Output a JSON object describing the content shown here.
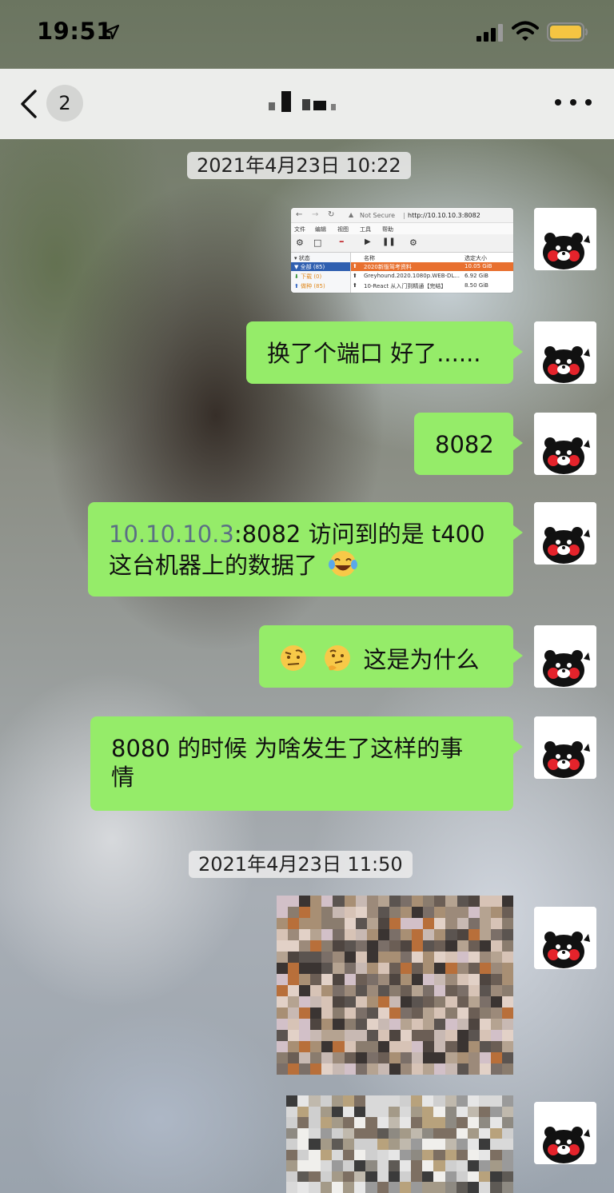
{
  "status_bar": {
    "time": "19:51"
  },
  "nav": {
    "unread_count": "2"
  },
  "colors": {
    "bubble": "#95ec69",
    "navbar": "#ecedeb"
  },
  "chat": {
    "timestamp_1": "2021年4月23日 10:22",
    "timestamp_2": "2021年4月23日 11:50",
    "screenshot": {
      "url_prefix": "Not Secure",
      "url": "http://10.10.10.3:8082",
      "menu": [
        "文件",
        "编辑",
        "视图",
        "工具",
        "帮助"
      ],
      "sidebar": [
        "状态",
        "全部 (85)",
        "下载 (0)",
        "做种 (85)"
      ],
      "headers": [
        "名称",
        "选定大小"
      ],
      "rows": [
        {
          "name": "2020新版驾考资料",
          "size": "10.05 GiB"
        },
        {
          "name": "Greyhound.2020.1080p.WEB-DL...",
          "size": "6.92 GiB"
        },
        {
          "name": "10-React 从入门到精通【完结】",
          "size": "8.50 GiB"
        }
      ]
    },
    "messages": [
      {
        "text": "换了个端口 好了......"
      },
      {
        "text": "8082"
      },
      {
        "link": "10.10.10.3",
        "text_a": ":8082 访问到的是 t400",
        "text_b": "这台机器上的数据了"
      },
      {
        "text": "这是为什么"
      },
      {
        "line1": "8080 的时候 为啥发生了这样的事",
        "line2": "情"
      }
    ]
  }
}
